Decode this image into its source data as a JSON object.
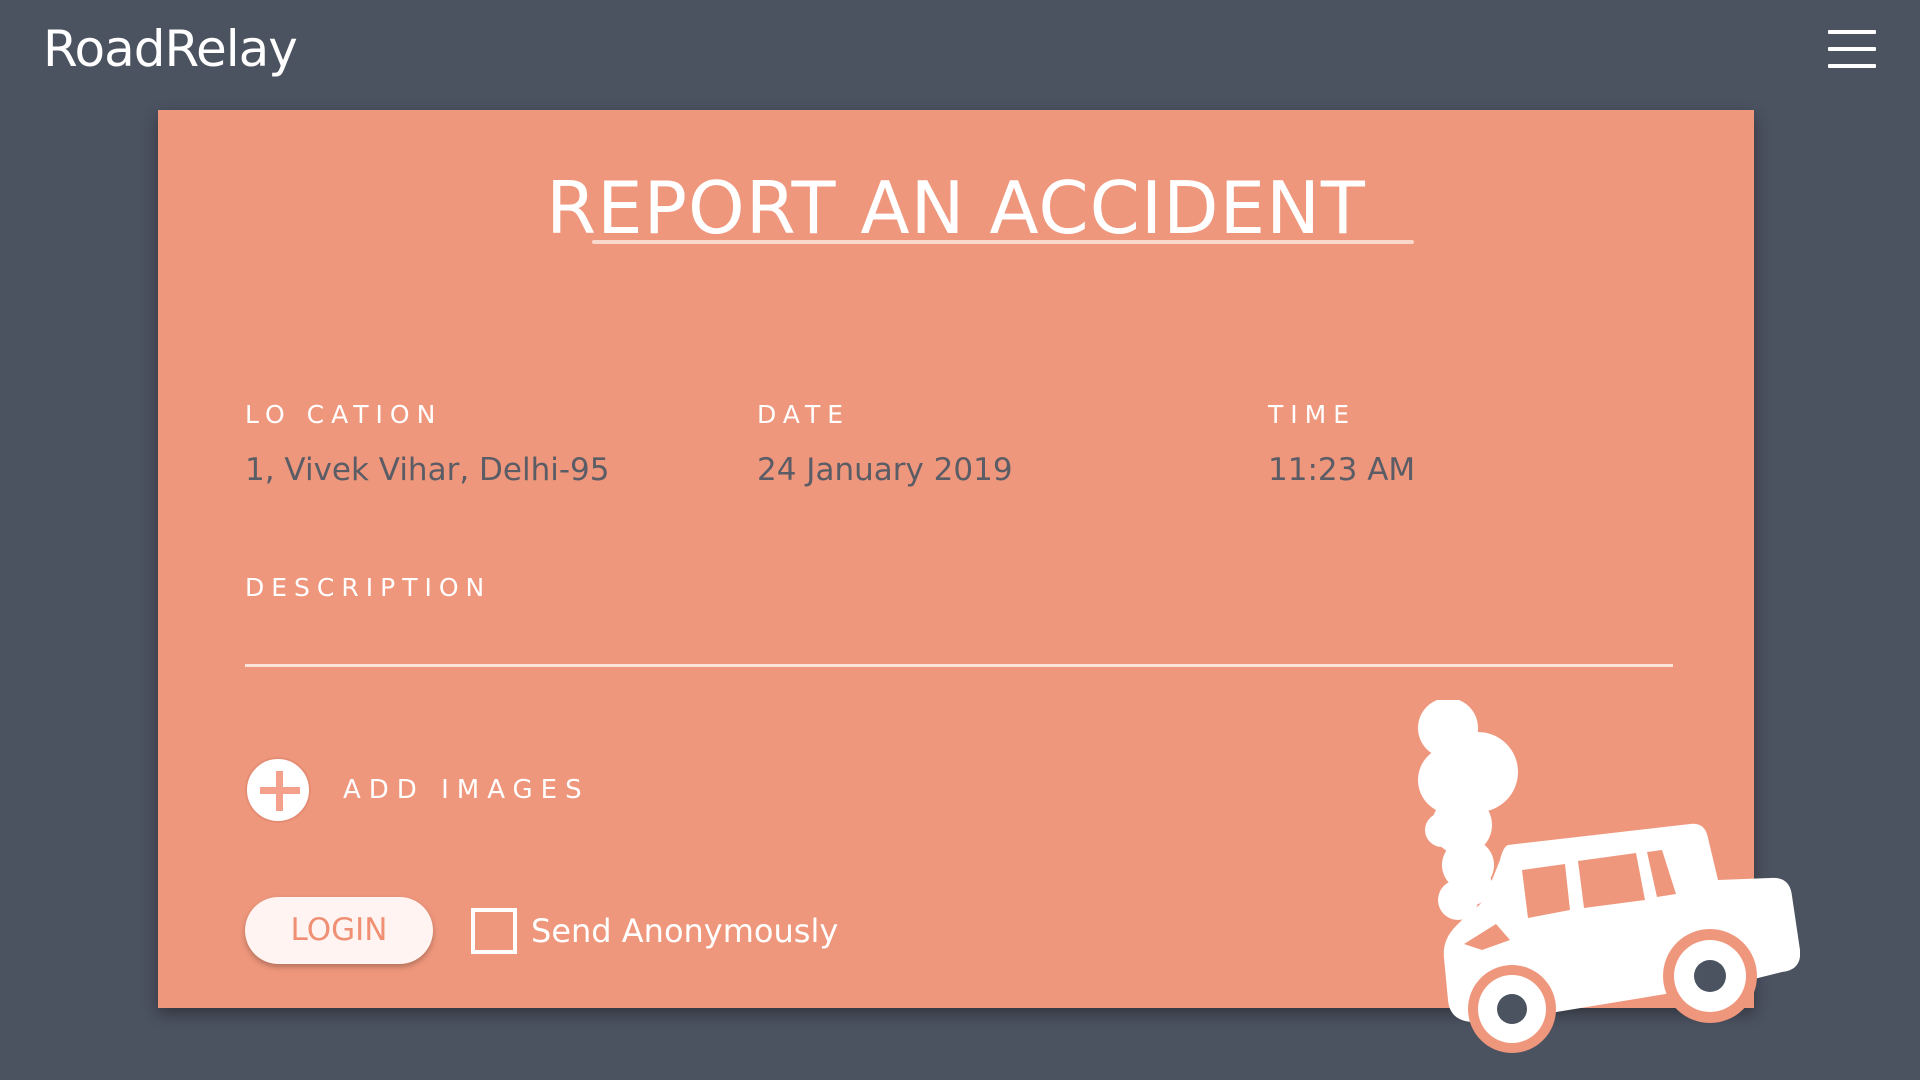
{
  "header": {
    "brand": "RoadRelay",
    "menu_icon": "hamburger-menu-icon"
  },
  "form": {
    "title": "REPORT AN ACCIDENT",
    "location": {
      "label": "LO CATION",
      "value": "1, Vivek Vihar, Delhi-95"
    },
    "date": {
      "label": "DATE",
      "value": "24 January 2019"
    },
    "time": {
      "label": "TIME",
      "value": "11:23 AM"
    },
    "description": {
      "label": "DESCRIPTION",
      "value": ""
    },
    "add_images": {
      "label": "ADD IMAGES",
      "icon": "plus-circle-icon"
    },
    "login_label": "LOGIN",
    "anonymous": {
      "label": "Send Anonymously",
      "checked": false
    }
  },
  "illustration": {
    "icon": "crashed-car-smoke-icon"
  },
  "colors": {
    "background": "#4b5260",
    "card": "#ef977c",
    "value_text": "#5a5c66",
    "accent": "#ffffff"
  }
}
